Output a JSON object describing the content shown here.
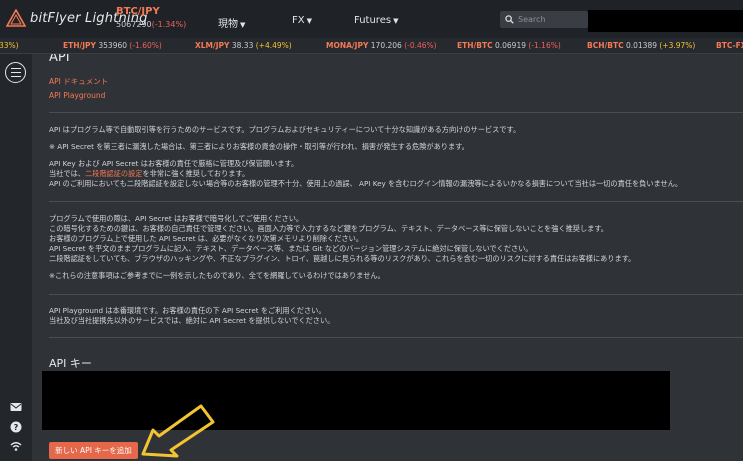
{
  "brand": {
    "name": "bitFlyer Lightning"
  },
  "header": {
    "pair": "BTC/JPY",
    "price": "5067290",
    "change": "(-1.34%)",
    "nav": [
      {
        "label": "現物"
      },
      {
        "label": "FX"
      },
      {
        "label": "Futures"
      }
    ],
    "search_placeholder": "Search"
  },
  "ticker": [
    {
      "symbol": "",
      "value": "",
      "change": "33%)",
      "dir": "up"
    },
    {
      "symbol": "ETH/JPY",
      "value": "353960",
      "change": "(-1.60%)",
      "dir": "down"
    },
    {
      "symbol": "XLM/JPY",
      "value": "38.33",
      "change": "(+4.49%)",
      "dir": "up"
    },
    {
      "symbol": "MONA/JPY",
      "value": "170.206",
      "change": "(-0.46%)",
      "dir": "down"
    },
    {
      "symbol": "ETH/BTC",
      "value": "0.06919",
      "change": "(-1.16%)",
      "dir": "down"
    },
    {
      "symbol": "BCH/BTC",
      "value": "0.01389",
      "change": "(+3.97%)",
      "dir": "up"
    },
    {
      "symbol": "BTC-FX",
      "value": "",
      "change": "",
      "dir": "up"
    }
  ],
  "page": {
    "title": "API",
    "links": [
      "API ドキュメント",
      "API Playground"
    ],
    "p1": "API はプログラム等で自動取引等を行うためのサービスです。プログラムおよびセキュリティーについて十分な知識がある方向けのサービスです。",
    "p2": "※ API Secret を第三者に漏洩した場合は、第三者によりお客様の資金の操作・取引等が行われ、損害が発生する危険があります。",
    "p3a": "API Key および API Secret はお客様の責任で厳格に管理及び保管願います。",
    "p3b_pre": "当社では、",
    "p3b_link": "二段階認証の設定",
    "p3b_post": "を非常に強く推奨しております。",
    "p3c": "API のご利用においても二段階認証を設定しない場合等のお客様の管理不十分、使用上の過誤、 API Key を含むログイン情報の漏洩等によるいかなる損害について当社は一切の責任を負いません。",
    "p4a": "プログラムで使用の際は、API Secret はお客様で暗号化してご使用ください。",
    "p4b": "この暗号化するための鍵は、お客様の自己責任で管理ください。画面入力等で入力するなど鍵をプログラム、テキスト、データベース等に保管しないことを強く推奨します。",
    "p4c": "お客様のプログラム上で使用した API Secret は、必要がなくなり次第メモリより削除ください。",
    "p4d": "API Secret を平文のままプログラムに記入、テキスト、データベース等、または Git などのバージョン管理システムに絶対に保管しないでください。",
    "p4e": "二段階認証をしていても、ブラウザのハッキングや、不正なプラグイン、トロイ、罠越しに見られる等のリスクがあり、これらを含む一切のリスクに対する責任はお客様にあります。",
    "p5": "※これらの注意事項はご参考までに一例を示したものであり、全てを網羅しているわけではありません。",
    "p6a": "API Playground は本番環境です。お客様の責任の下 API Secret をご利用ください。",
    "p6b": "当社及び当社提携先以外のサービスでは、絶対に API Secret を提供しないでください。",
    "section_title": "API キー",
    "add_button": "新しい API キーを追加"
  },
  "colors": {
    "accent": "#f47a56",
    "button": "#e5684a",
    "arrow": "#f4c430"
  }
}
